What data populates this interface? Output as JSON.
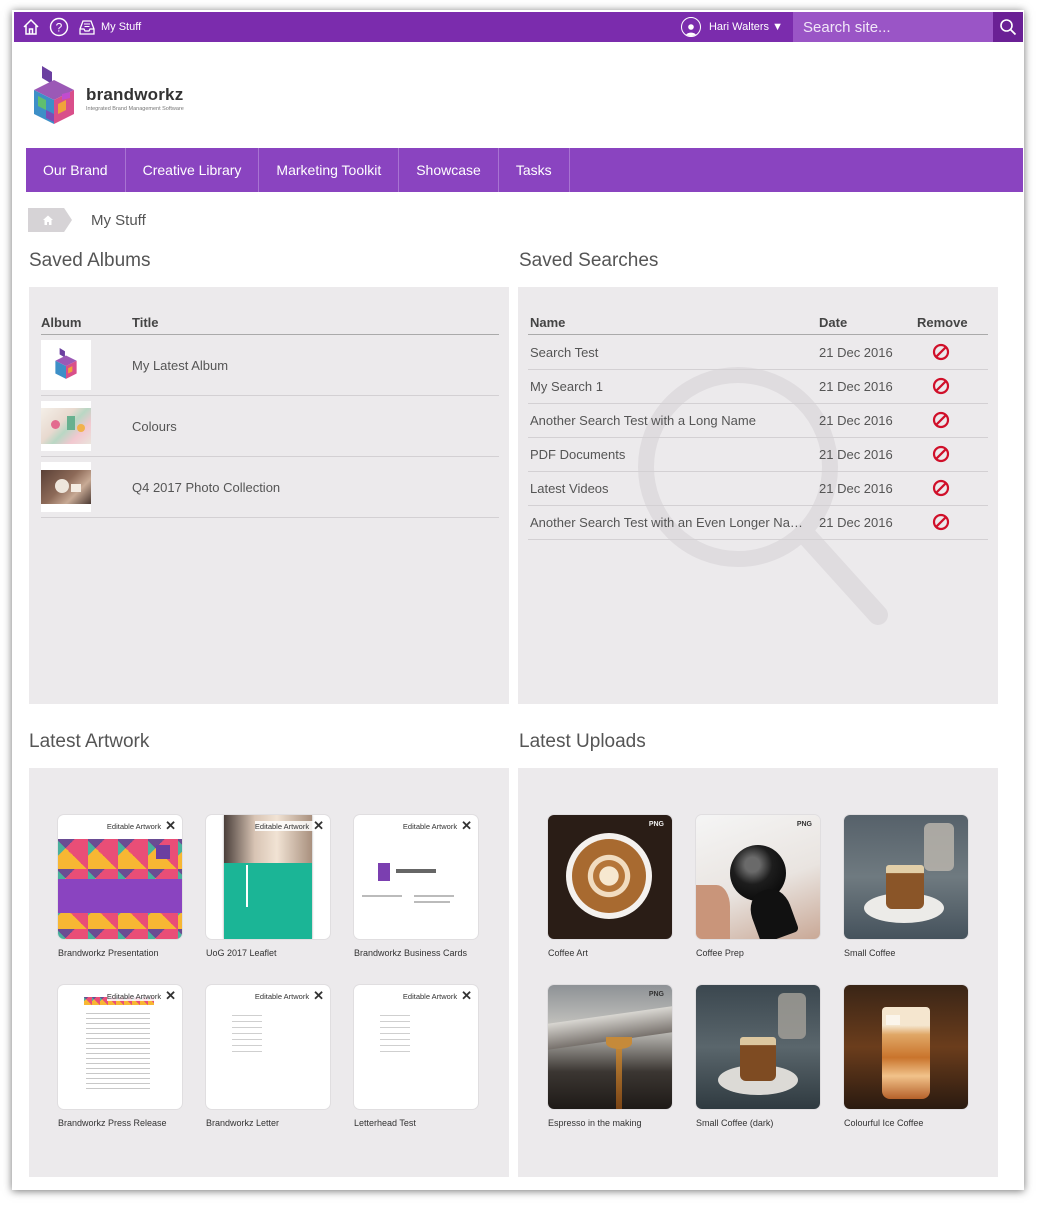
{
  "topbar": {
    "my_stuff_label": "My Stuff",
    "user_name": "Hari Walters ▼",
    "search_placeholder": "Search site..."
  },
  "logo": {
    "name": "brandworkz",
    "tagline": "Integrated Brand Management Software"
  },
  "nav": [
    "Our Brand",
    "Creative Library",
    "Marketing Toolkit",
    "Showcase",
    "Tasks"
  ],
  "breadcrumb": {
    "current": "My Stuff"
  },
  "saved_albums": {
    "title": "Saved Albums",
    "headers": {
      "album": "Album",
      "title": "Title"
    },
    "rows": [
      {
        "title": "My Latest Album"
      },
      {
        "title": "Colours"
      },
      {
        "title": "Q4 2017 Photo Collection"
      }
    ]
  },
  "saved_searches": {
    "title": "Saved Searches",
    "headers": {
      "name": "Name",
      "date": "Date",
      "remove": "Remove"
    },
    "rows": [
      {
        "name": "Search Test",
        "date": "21 Dec 2016"
      },
      {
        "name": "My Search 1",
        "date": "21 Dec 2016"
      },
      {
        "name": "Another Search Test with a Long Name",
        "date": "21 Dec 2016"
      },
      {
        "name": "PDF Documents",
        "date": "21 Dec 2016"
      },
      {
        "name": "Latest Videos",
        "date": "21 Dec 2016"
      },
      {
        "name": "Another Search Test with an Even Longer Name",
        "date": "21 Dec 2016"
      }
    ]
  },
  "latest_artwork": {
    "title": "Latest Artwork",
    "badge": "Editable Artwork",
    "items": [
      {
        "caption": "Brandworkz Presentation"
      },
      {
        "caption": "UoG 2017 Leaflet"
      },
      {
        "caption": "Brandworkz Business Cards"
      },
      {
        "caption": "Brandworkz Press Release"
      },
      {
        "caption": "Brandworkz Letter"
      },
      {
        "caption": "Letterhead Test"
      }
    ]
  },
  "latest_uploads": {
    "title": "Latest Uploads",
    "badge": "PNG",
    "items": [
      {
        "caption": "Coffee Art"
      },
      {
        "caption": "Coffee Prep"
      },
      {
        "caption": "Small Coffee"
      },
      {
        "caption": "Espresso in the making"
      },
      {
        "caption": "Small Coffee (dark)"
      },
      {
        "caption": "Colourful Ice Coffee"
      }
    ]
  },
  "colors": {
    "top_bar": "#7b2cad",
    "nav": "#8a44c0",
    "panel": "#eceaec",
    "remove": "#d0102a"
  }
}
